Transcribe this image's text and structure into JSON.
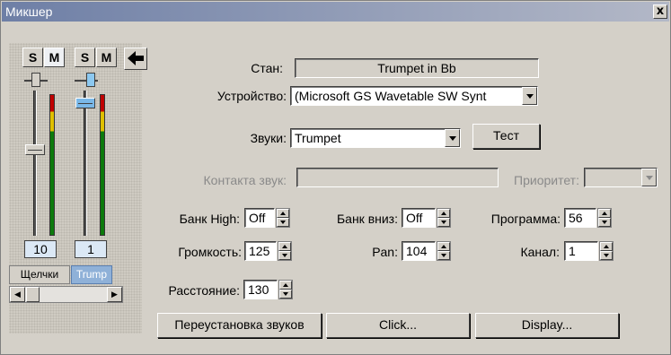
{
  "window": {
    "title": "Микшер",
    "close_label": "x"
  },
  "strip": {
    "channels": [
      {
        "solo_label": "S",
        "mute_label": "M",
        "value": "10",
        "tab": "Щелчки"
      },
      {
        "solo_label": "S",
        "mute_label": "M",
        "value": "1",
        "tab": "Trump"
      }
    ]
  },
  "form": {
    "staff_label": "Стан:",
    "staff_value": "Trumpet in Bb",
    "device_label": "Устройство:",
    "device_value": "(Microsoft GS Wavetable SW Synt",
    "sounds_label": "Звуки:",
    "sounds_value": "Trumpet",
    "test_label": "Тест",
    "contact_label": "Контакта звук:",
    "contact_value": "",
    "priority_label": "Приоритет:",
    "priority_value": "",
    "bank_high_label": "Банк High:",
    "bank_high_value": "Off",
    "bank_low_label": "Банк вниз:",
    "bank_low_value": "Off",
    "program_label": "Программа:",
    "program_value": "56",
    "volume_label": "Громкость:",
    "volume_value": "125",
    "pan_label": "Pan:",
    "pan_value": "104",
    "channel_label": "Канал:",
    "channel_value": "1",
    "distance_label": "Расстояние:",
    "distance_value": "130"
  },
  "buttons": {
    "reassign_label": "Переустановка звуков",
    "click_label": "Click...",
    "display_label": "Display..."
  }
}
